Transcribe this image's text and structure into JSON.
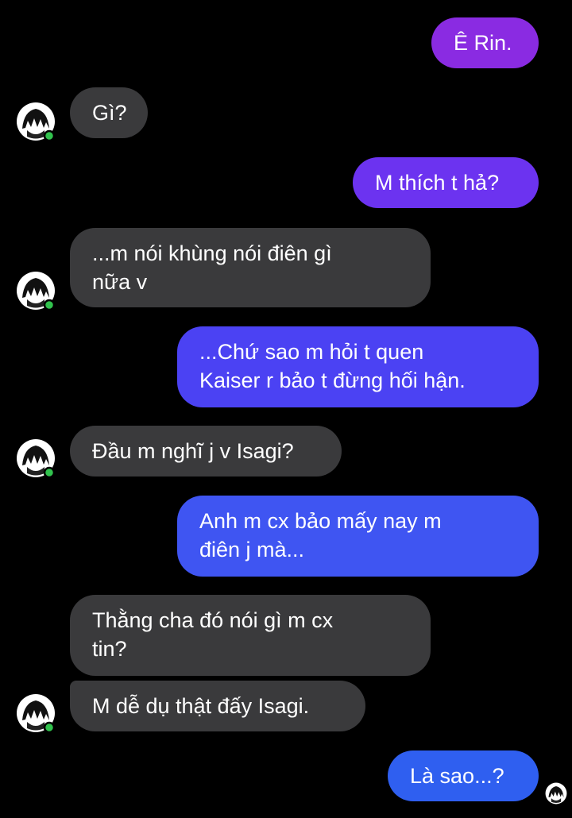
{
  "colors": {
    "background": "#000000",
    "incoming_bubble": "#3a3a3c",
    "outgoing_purple": "#8a2be2",
    "outgoing_indigo": "#5b3cf5",
    "outgoing_blue": "#2f5ff0",
    "online_dot": "#31c24d"
  },
  "contact": {
    "avatar_icon": "anime-avatar-icon",
    "online_indicator": "online-dot-icon"
  },
  "messages": [
    {
      "sender": "me",
      "text": "Ê Rin."
    },
    {
      "sender": "contact",
      "text": "Gì?"
    },
    {
      "sender": "me",
      "text": "M thích t hả?"
    },
    {
      "sender": "contact",
      "text": "...m nói khùng nói điên gì\nnữa v"
    },
    {
      "sender": "me",
      "text": "...Chứ sao m hỏi t quen\nKaiser r bảo t đừng hối hận."
    },
    {
      "sender": "contact",
      "text": "Đầu m nghĩ j v Isagi?"
    },
    {
      "sender": "me",
      "text": "Anh m cx bảo mấy nay m\nđiên j mà..."
    },
    {
      "sender": "contact",
      "text": "Thằng cha đó nói gì m cx\ntin?"
    },
    {
      "sender": "contact",
      "text": "M dễ dụ thật đấy Isagi."
    },
    {
      "sender": "me",
      "text": "Là sao...?"
    }
  ],
  "seen_indicator": "seen-avatar-icon"
}
